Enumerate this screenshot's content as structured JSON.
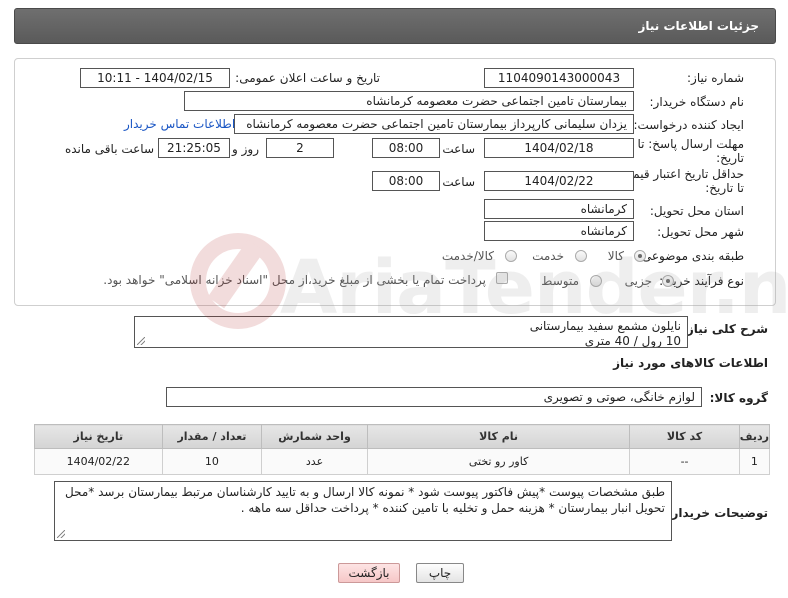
{
  "header": {
    "title": "جزئیات اطلاعات نیاز"
  },
  "form": {
    "need_number": {
      "label": "شماره نیاز:",
      "value": "1104090143000043"
    },
    "announce_datetime": {
      "label": "تاریخ و ساعت اعلان عمومی:",
      "value": "1404/02/15 - 10:11"
    },
    "buyer_org": {
      "label": "نام دستگاه خریدار:",
      "value": "بیمارستان تامین اجتماعی حضرت معصومه کرمانشاه"
    },
    "creator": {
      "label": "ایجاد کننده درخواست:",
      "value": "یزدان  سلیمانی کارپرداز بیمارستان تامین اجتماعی حضرت معصومه کرمانشاه",
      "link": "اطلاعات تماس خریدار"
    },
    "reply_deadline": {
      "label": "مهلت ارسال پاسخ: تا تاریخ:",
      "date": "1404/02/18",
      "time_label": "ساعت",
      "time": "08:00",
      "days": "2",
      "days_label": "روز و",
      "remaining": "21:25:05",
      "remaining_label": "ساعت باقی مانده"
    },
    "price_validity": {
      "label": "حداقل تاریخ اعتبار قیمت: تا تاریخ:",
      "date": "1404/02/22",
      "time_label": "ساعت",
      "time": "08:00"
    },
    "delivery_province": {
      "label": "استان محل تحویل:",
      "value": "کرمانشاه"
    },
    "delivery_city": {
      "label": "شهر محل تحویل:",
      "value": "کرمانشاه"
    },
    "category": {
      "label": "طبقه بندی موضوعی:",
      "options": [
        "کالا",
        "خدمت",
        "کالا/خدمت"
      ],
      "selected": "کالا"
    },
    "process_type": {
      "label": "نوع فرآیند خرید :",
      "options": [
        "جزیی",
        "متوسط"
      ],
      "selected": "جزیی",
      "payment_note": "پرداخت تمام یا بخشی از مبلغ خرید،از محل \"اسناد خزانه اسلامی\" خواهد بود."
    }
  },
  "summary": {
    "label": "شرح کلی نیاز:",
    "line1": "نایلون مشمع سفید بیمارستانی",
    "line2": "10 رول / 40 متری"
  },
  "goods_info": {
    "title": "اطلاعات کالاهای مورد نیاز"
  },
  "goods_group": {
    "label": "گروه کالا:",
    "value": "لوازم خانگی، صوتی و تصویری"
  },
  "table": {
    "headers": [
      "ردیف",
      "کد کالا",
      "نام کالا",
      "واحد شمارش",
      "تعداد / مقدار",
      "تاریخ نیاز"
    ],
    "rows": [
      [
        "1",
        "--",
        "کاور رو تختی",
        "عدد",
        "10",
        "1404/02/22"
      ]
    ]
  },
  "buyer_notes": {
    "label": "توضیحات خریدار:",
    "text": "طبق مشخصات پیوست *پیش فاکتور پیوست شود * نمونه کالا ارسال و به تایید کارشناسان مرتبط بیمارستان برسد *محل تحویل انبار بیمارستان * هزینه حمل و تخلیه با تامین کننده * پرداخت حداقل سه ماهه ."
  },
  "buttons": {
    "print": "چاپ",
    "back": "بازگشت"
  },
  "watermark": {
    "text": "AriaTender.neT"
  }
}
